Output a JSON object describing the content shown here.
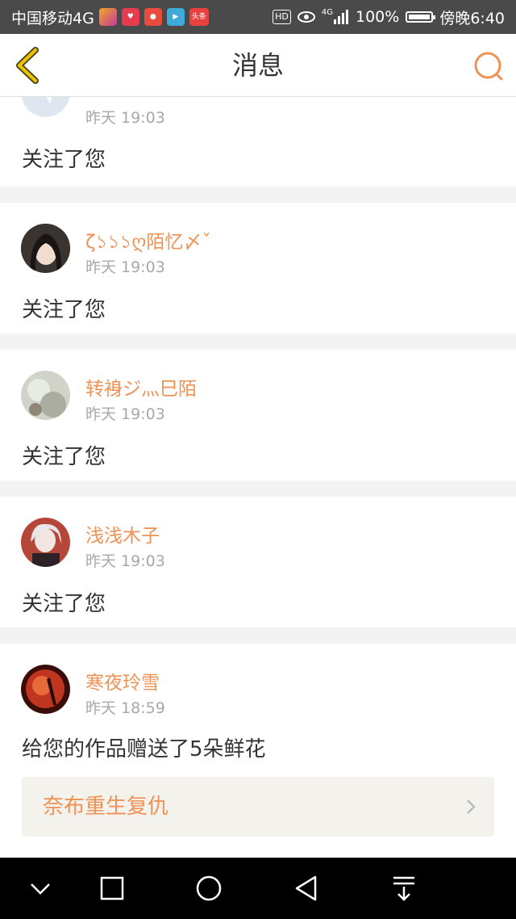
{
  "status_bar": {
    "carrier": "中国移动4G",
    "battery": "100%",
    "time": "傍晚6:40",
    "net_label": "4G",
    "hd_label": "HD",
    "app_badge": "头条",
    "battery_level": 1.0
  },
  "header": {
    "title": "消息",
    "back_icon": "chevron-left-icon",
    "search_icon": "search-icon"
  },
  "accent_color": "#ef9255",
  "messages": [
    {
      "user": "",
      "time": "昨天 19:03",
      "text": "关注了您"
    },
    {
      "user": "ζ১১১ღ陌忆〆ˇ",
      "time": "昨天 19:03",
      "text": "关注了您"
    },
    {
      "user": "转裑ジ灬巳陌",
      "time": "昨天 19:03",
      "text": "关注了您"
    },
    {
      "user": "浅浅木子",
      "time": "昨天 19:03",
      "text": "关注了您"
    },
    {
      "user": "寒夜玲雪",
      "time": "昨天 18:59",
      "text": "给您的作品赠送了5朵鲜花",
      "work_title": "奈布重生复仇"
    }
  ],
  "system_nav": [
    "chevron-down-icon",
    "square-icon",
    "circle-icon",
    "triangle-back-icon",
    "download-icon"
  ]
}
